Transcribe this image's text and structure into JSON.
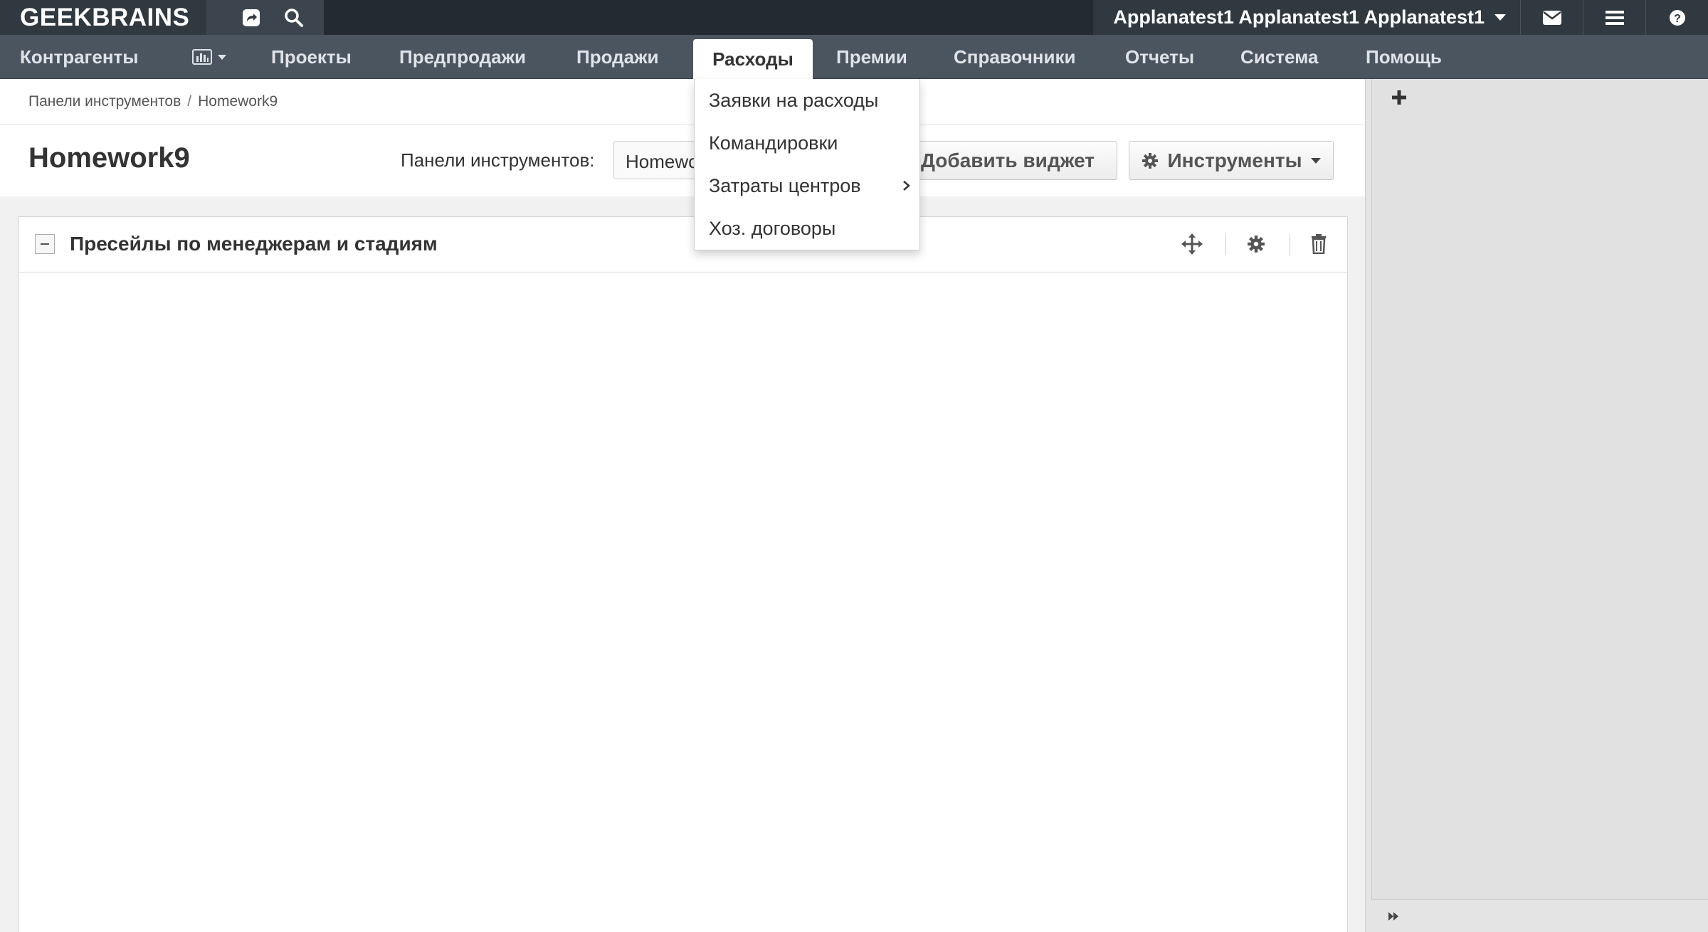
{
  "app": {
    "logo": "GEEKBRAINS"
  },
  "topbar": {
    "user_name": "Applanatest1 Applanatest1 Applanatest1",
    "icons": [
      "share-icon",
      "search-icon",
      "envelope-icon",
      "menu-icon",
      "help-icon"
    ]
  },
  "nav": {
    "items": [
      {
        "label": "Контрагенты"
      },
      {
        "label": ""
      },
      {
        "label": "Проекты"
      },
      {
        "label": "Предпродажи"
      },
      {
        "label": "Продажи"
      },
      {
        "label": "Расходы"
      },
      {
        "label": "Премии"
      },
      {
        "label": "Справочники"
      },
      {
        "label": "Отчеты"
      },
      {
        "label": "Система"
      },
      {
        "label": "Помощь"
      }
    ],
    "active_label": "Расходы"
  },
  "dropdown": {
    "items": [
      {
        "label": "Заявки на расходы"
      },
      {
        "label": "Командировки"
      },
      {
        "label": "Затраты центров",
        "has_submenu": true
      },
      {
        "label": "Хоз. договоры"
      }
    ]
  },
  "breadcrumb": {
    "items": [
      "Панели инструментов",
      "Homework9"
    ],
    "separator": "/"
  },
  "header": {
    "title": "Homework9",
    "dashboards_label": "Панели инструментов:",
    "dashboard_select_value": "Homework9",
    "add_widget_label": "Добавить виджет",
    "tools_label": "Инструменты"
  },
  "widget": {
    "title": "Пресейлы по менеджерам и стадиям"
  },
  "colors": {
    "topbar": "#303840",
    "navbar": "#4a5560",
    "content_bg": "#f1f1f1",
    "sidebar_bg": "#e1e1e1"
  }
}
